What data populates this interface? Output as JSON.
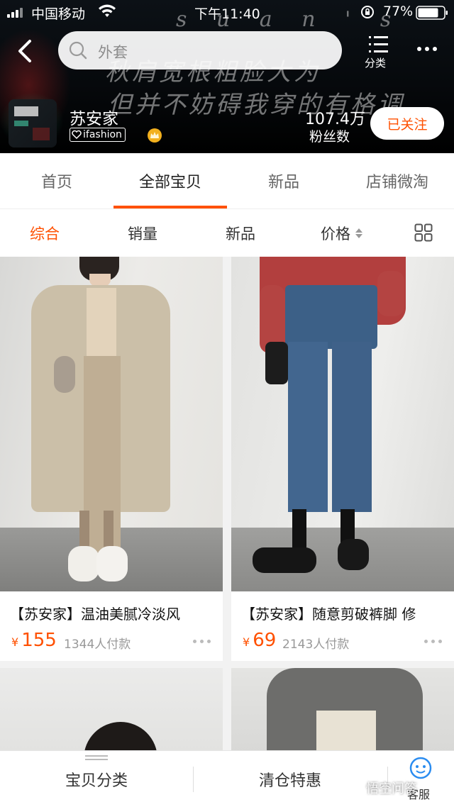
{
  "status_bar": {
    "carrier": "中国移动",
    "time": "下午11:40",
    "battery": "77%"
  },
  "nav": {
    "search_placeholder": "外套",
    "category_label": "分类"
  },
  "banner_text": {
    "line1": "s u a n ' s",
    "line2": "秋肩宽根粗脸大为",
    "line3": "但并不妨碍我穿的有格调"
  },
  "shop": {
    "name": "苏安家",
    "badge": "ifashion",
    "fans_count": "107.4万",
    "fans_label": "粉丝数",
    "follow_label": "已关注"
  },
  "tabs": [
    "首页",
    "全部宝贝",
    "新品",
    "店铺微淘"
  ],
  "active_tab": 1,
  "sort": {
    "items": [
      "综合",
      "销量",
      "新品",
      "价格"
    ],
    "active": 0
  },
  "products": [
    {
      "title": "【苏安家】温油美腻冷淡风",
      "currency": "¥",
      "price": "155",
      "sold": "1344人付款"
    },
    {
      "title": "【苏安家】随意剪破裤脚 修",
      "currency": "¥",
      "price": "69",
      "sold": "2143人付款"
    }
  ],
  "bottom_bar": {
    "left": "宝贝分类",
    "middle": "清仓特惠",
    "service": "客服"
  },
  "watermark": "悟空问答",
  "colors": {
    "accent": "#ff5000",
    "header_bg": "#000000",
    "text_muted": "#999999"
  }
}
